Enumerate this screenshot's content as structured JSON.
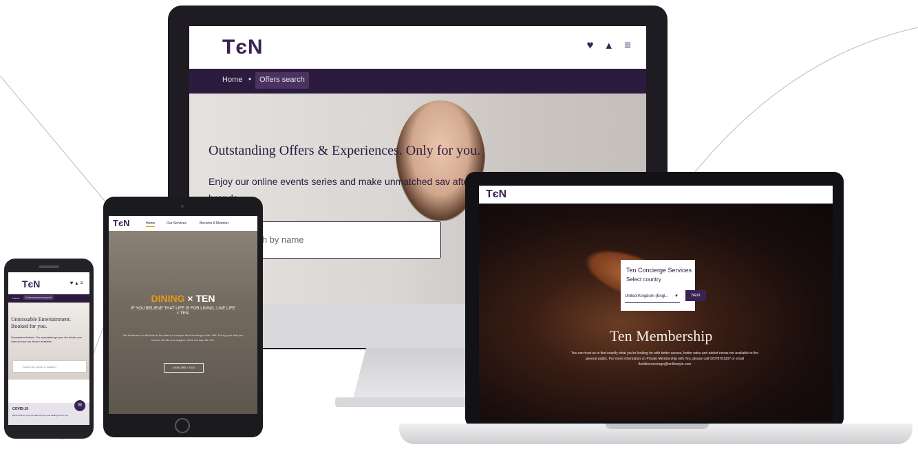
{
  "desktop": {
    "logo": "TєN",
    "icons": [
      "heart-icon",
      "user-icon",
      "menu-icon"
    ],
    "breadcrumb": {
      "home": "Home",
      "current": "Offers search"
    },
    "headline": "Outstanding Offers & Experiences. Only for you.",
    "subtext": "Enjoy our online events series and make unmatched sav after brands",
    "search_placeholder": "rch by name"
  },
  "laptop": {
    "logo": "TєN",
    "card_title": "Ten Concierge Services",
    "card_subtitle": "Select country",
    "country_value": "United Kingdom (Engl...",
    "next_button": "Next",
    "heading": "Ten Membership",
    "body_text": "You can trust us to find exactly what you're looking for with better access, better rates and added extras not available to the general public. For more information on Private Membership with Ten, please call 02078781307 or email flexibleconcierge@tenlifestyle.com"
  },
  "tablet": {
    "logo": "TєN",
    "nav": [
      "Home",
      "Our Services",
      "Become A Member"
    ],
    "dining_accent": "DINING",
    "dining_rest": "× TEN",
    "tagline": "IF YOU BELIEVE THAT LIFE IS FOR LIVING, LIVE LIFE × TEN.",
    "paragraph": "We all dream of a life lived in the fullest, to sample the finer things in life. With Ten by your side you can live the life you imagine. Seize the day with Ten.",
    "button": "EXPLORE × TEN"
  },
  "phone": {
    "logo": "TєN",
    "icons": [
      "heart-icon",
      "user-icon",
      "menu-icon"
    ],
    "breadcrumb": {
      "home": "Home",
      "current": "Entertainment search"
    },
    "headline": "Unmissable Entertainment. Booked for you.",
    "subtext": "Guaranteed tickets. Our specialists get you the tickets you want as soon as they're available.",
    "search_placeholder": "Search by name or location",
    "covid_title": "COVID-19",
    "covid_text": "We're here for you. Our team is here, and looking out for you."
  },
  "colors": {
    "brand": "#3a2352",
    "accent": "#e59a1a",
    "breadcrumb_bg": "#2d1b3e"
  }
}
